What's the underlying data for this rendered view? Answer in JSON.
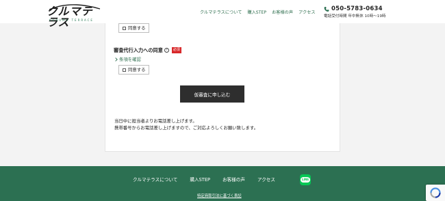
{
  "header": {
    "logo_text": "クルマテラス",
    "logo_sub": "KURUMA TERRACE",
    "nav": [
      {
        "label": "クルマテラスについて"
      },
      {
        "label": "購入STEP"
      },
      {
        "label": "お客様の声"
      },
      {
        "label": "アクセス"
      }
    ],
    "phone": "050-5783-0634",
    "hours": "電話受付時間 年中無休 10時〜19時"
  },
  "form": {
    "consent_checkbox_1": "同意する",
    "agency_label": "審査代行入力への同意",
    "help_glyph": "?",
    "required_badge": "必須",
    "terms_link": "条項を確認",
    "consent_checkbox_2": "同意する",
    "submit_label": "仮審査に申し込む",
    "notice_lines": [
      "当日中に担当者よりお電話差し上げます。",
      "携帯番号からお電話差し上げますので、ご対応よろしくお願い致します。"
    ]
  },
  "footer": {
    "nav": [
      {
        "label": "クルマテラスについて"
      },
      {
        "label": "購入STEP"
      },
      {
        "label": "お客様の声"
      },
      {
        "label": "アクセス"
      }
    ],
    "line_label": "LINE",
    "legal_link": "特定商取引法に基づく表記"
  },
  "colors": {
    "brand_green": "#2c7052",
    "required_red": "#d8282a",
    "submit_dark": "#2e2e2e",
    "line_green": "#06c755"
  },
  "icons": [
    "phone-icon",
    "chevron-right-icon",
    "help-icon",
    "line-icon",
    "recaptcha-icon",
    "car-logo-icon"
  ]
}
